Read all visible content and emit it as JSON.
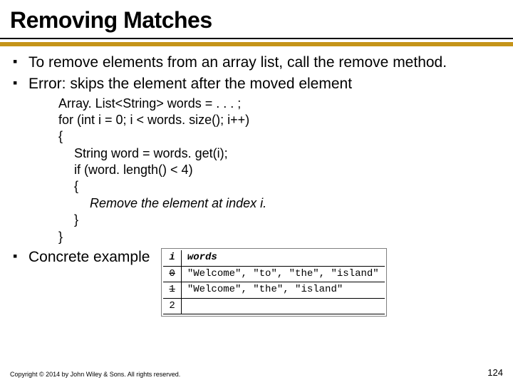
{
  "title": "Removing Matches",
  "bullets": {
    "b1": "To remove elements from an array list, call the remove method.",
    "b2": "Error: skips the element after the moved element",
    "b3": "Concrete example"
  },
  "code": {
    "l1": "Array. List<String> words = . . . ;",
    "l2": "for (int i = 0; i < words. size(); i++)",
    "l3": "{",
    "l4": "String word = words. get(i);",
    "l5": "if (word. length() < 4)",
    "l6": "{",
    "l7": "Remove the element at index i.",
    "l8": "}",
    "l9": "}"
  },
  "table": {
    "head": {
      "c0": "i",
      "c1": "words"
    },
    "rows": [
      {
        "c0": "0",
        "c0_strike": true,
        "c1": "\"Welcome\", \"to\", \"the\", \"island\""
      },
      {
        "c0": "1",
        "c0_strike": true,
        "c1": "\"Welcome\", \"the\", \"island\""
      },
      {
        "c0": "2",
        "c0_strike": false,
        "c1": ""
      }
    ]
  },
  "footer": "Copyright © 2014 by John Wiley & Sons. All rights reserved.",
  "pagenum": "124"
}
